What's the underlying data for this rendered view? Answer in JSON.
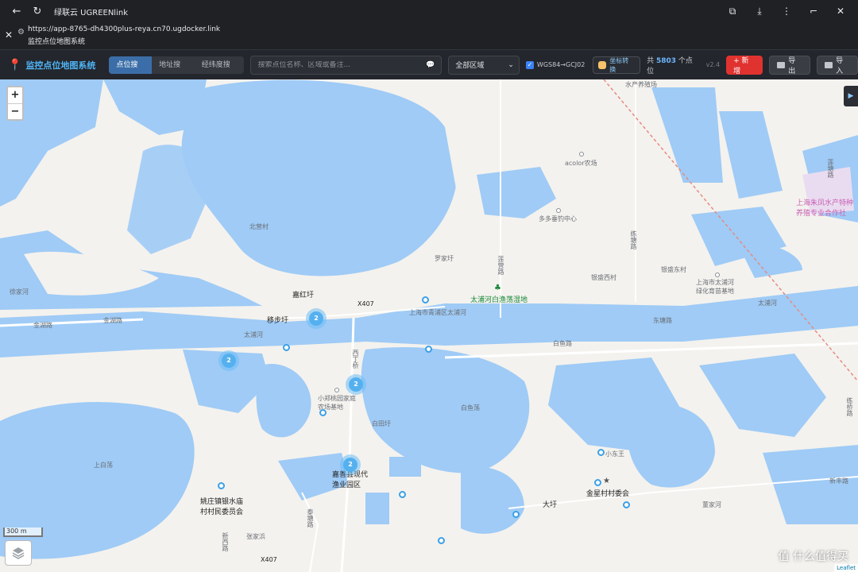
{
  "browser": {
    "app_title": "绿联云 UGREENlink",
    "url": "https://app-8765-dh4300plus-reya.cn70.ugdocker.link",
    "page_title": "监控点位地图系统"
  },
  "toolbar": {
    "brand": "监控点位地图系统",
    "tabs": [
      {
        "label": "点位搜索",
        "active": true
      },
      {
        "label": "地址搜索",
        "active": false
      },
      {
        "label": "经纬度搜索",
        "active": false
      }
    ],
    "search_placeholder": "搜索点位名称、区域或备注...",
    "region_value": "全部区域",
    "wgs_label": "WGS84→GCJ02",
    "convert_label": "坐标转换",
    "count_prefix": "共",
    "count_value": "5803",
    "count_suffix": "个点位",
    "version": "v2.4",
    "new_label": "+ 新增",
    "export_label": "导出",
    "import_label": "导入"
  },
  "map": {
    "zoom_in": "+",
    "zoom_out": "−",
    "scale_label": "300 m",
    "attribution": "Leaflet",
    "watermark": "值 什么值得买",
    "cluster_count": "2",
    "labels": {
      "aquafarm": "水产养殖场",
      "acolor": "acolor农场",
      "duoduo": "多多垂钓中心",
      "beiying": "北营村",
      "luojiaqiao": "罗家圩",
      "lianyinglu": "莲营路",
      "taipu_wetland": "太浦河白渔荡湿地",
      "xijiahe": "徐家河",
      "jiahongyu": "嘉红圩",
      "yibuyu": "移步圩",
      "x407": "X407",
      "x407b": "X407",
      "shanghai_taipu": "上海市青浦区太浦河",
      "shanghai_taipu2": "上海市太浦河",
      "greenfarm": "绿化育苗基地",
      "taipuhe": "太浦河",
      "taipuhe2": "太浦河",
      "jinhulu": "金湖路",
      "jinhu": "金湖路",
      "baiyulu": "白鱼路",
      "qiaoganglu": "练塘路",
      "xidingqiao": "西丁桥",
      "xiaozheng": "小郑桃园家庭农场基地",
      "baiyudang": "白鱼荡",
      "baitianyu": "白田圩",
      "shangbaidang": "上白荡",
      "jiaxing_modern": "嘉善县现代渔业园区",
      "yaozhuang": "姚庄镇银水庙村村民委员会",
      "xiaodongwang": "小东王",
      "jinxingcun": "金星村村委会",
      "dayu": "大圩",
      "dongjiahe": "董家河",
      "xinxi": "新西路",
      "zhangjiaban": "张家浜",
      "shanghai_fish": "上海朱凤水产特种养殖专业合作社",
      "lutanglu": "莲塘路",
      "lianqiaolu": "练桥路",
      "xianglinlu": "新丰路",
      "jinfengdong": "银盛东村",
      "jinsheng": "银盛西村",
      "dongtang": "东塘路",
      "taitang": "泰塘路"
    }
  },
  "colors": {
    "water": "#9fcbf6",
    "land": "#f4f2ee",
    "brand": "#4fb3f4",
    "new_btn": "#e0322f"
  }
}
